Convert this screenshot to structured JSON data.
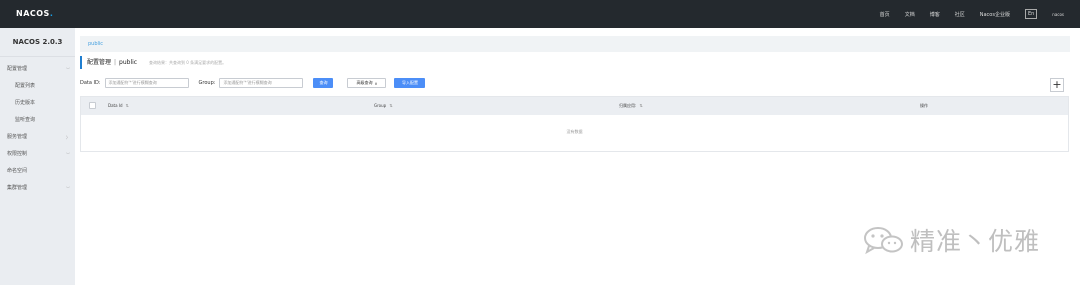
{
  "header": {
    "logo_prefix": "NACOS",
    "logo_suffix": ".",
    "nav": [
      "首页",
      "文档",
      "博客",
      "社区",
      "Nacos企业版"
    ],
    "lang": "En",
    "user": "nacos"
  },
  "sidebar": {
    "version": "NACOS 2.0.3",
    "items": [
      {
        "label": "配置管理",
        "chevron": "﹀"
      },
      {
        "label": "配置列表"
      },
      {
        "label": "历史版本"
      },
      {
        "label": "监听查询"
      },
      {
        "label": "服务管理",
        "chevron": "〉"
      },
      {
        "label": "权限控制",
        "chevron": "﹀"
      },
      {
        "label": "命名空间"
      },
      {
        "label": "集群管理",
        "chevron": "﹀"
      }
    ]
  },
  "main": {
    "breadcrumb": "public",
    "title": "配置管理",
    "title_sep": "|",
    "namespace": "public",
    "description": "查询结果：共查询到 0 条满足要求的配置。",
    "filters": {
      "data_id_label": "Data ID:",
      "data_id_placeholder": "添加通配符'*'进行模糊查询",
      "group_label": "Group:",
      "group_placeholder": "添加通配符'*'进行模糊查询",
      "query_button": "查询",
      "advanced_button": "高级查询",
      "advanced_chevron": "∨",
      "import_button": "导入配置",
      "plus": "+"
    },
    "table": {
      "columns": [
        "Data Id",
        "Group",
        "归属应用:",
        "操作"
      ],
      "sort_glyph": "⇅",
      "empty_text": "没有数据"
    }
  },
  "watermark": {
    "text": "精准丶优雅",
    "icon": "wechat-icon"
  }
}
